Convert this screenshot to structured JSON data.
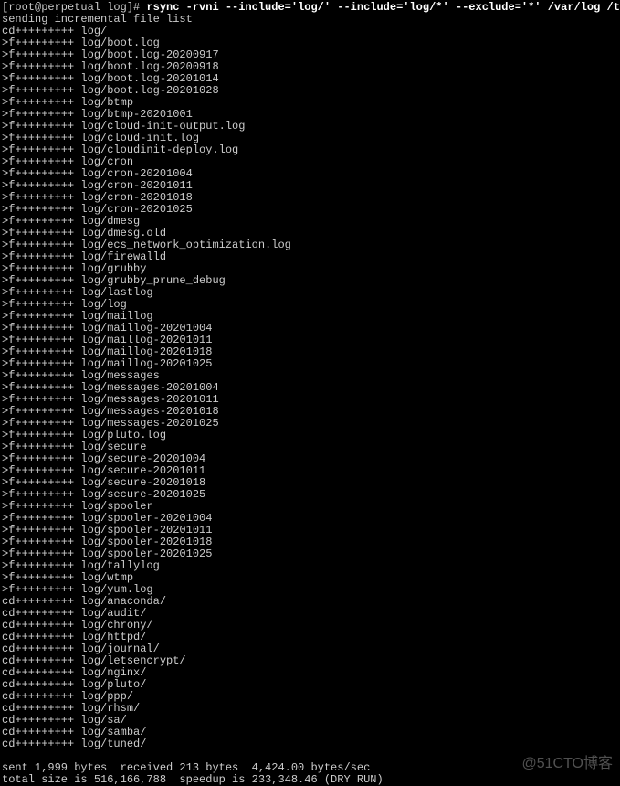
{
  "prompt": {
    "user_host": "[root@perpetual log]# ",
    "command": "rsync -rvni --include='log/' --include='log/*' --exclude='*' /var/log /tmp"
  },
  "header_line": "sending incremental file list",
  "entries": [
    {
      "flags": "cd+++++++++",
      "path": "log/"
    },
    {
      "flags": ">f+++++++++",
      "path": "log/boot.log"
    },
    {
      "flags": ">f+++++++++",
      "path": "log/boot.log-20200917"
    },
    {
      "flags": ">f+++++++++",
      "path": "log/boot.log-20200918"
    },
    {
      "flags": ">f+++++++++",
      "path": "log/boot.log-20201014"
    },
    {
      "flags": ">f+++++++++",
      "path": "log/boot.log-20201028"
    },
    {
      "flags": ">f+++++++++",
      "path": "log/btmp"
    },
    {
      "flags": ">f+++++++++",
      "path": "log/btmp-20201001"
    },
    {
      "flags": ">f+++++++++",
      "path": "log/cloud-init-output.log"
    },
    {
      "flags": ">f+++++++++",
      "path": "log/cloud-init.log"
    },
    {
      "flags": ">f+++++++++",
      "path": "log/cloudinit-deploy.log"
    },
    {
      "flags": ">f+++++++++",
      "path": "log/cron"
    },
    {
      "flags": ">f+++++++++",
      "path": "log/cron-20201004"
    },
    {
      "flags": ">f+++++++++",
      "path": "log/cron-20201011"
    },
    {
      "flags": ">f+++++++++",
      "path": "log/cron-20201018"
    },
    {
      "flags": ">f+++++++++",
      "path": "log/cron-20201025"
    },
    {
      "flags": ">f+++++++++",
      "path": "log/dmesg"
    },
    {
      "flags": ">f+++++++++",
      "path": "log/dmesg.old"
    },
    {
      "flags": ">f+++++++++",
      "path": "log/ecs_network_optimization.log"
    },
    {
      "flags": ">f+++++++++",
      "path": "log/firewalld"
    },
    {
      "flags": ">f+++++++++",
      "path": "log/grubby"
    },
    {
      "flags": ">f+++++++++",
      "path": "log/grubby_prune_debug"
    },
    {
      "flags": ">f+++++++++",
      "path": "log/lastlog"
    },
    {
      "flags": ">f+++++++++",
      "path": "log/log"
    },
    {
      "flags": ">f+++++++++",
      "path": "log/maillog"
    },
    {
      "flags": ">f+++++++++",
      "path": "log/maillog-20201004"
    },
    {
      "flags": ">f+++++++++",
      "path": "log/maillog-20201011"
    },
    {
      "flags": ">f+++++++++",
      "path": "log/maillog-20201018"
    },
    {
      "flags": ">f+++++++++",
      "path": "log/maillog-20201025"
    },
    {
      "flags": ">f+++++++++",
      "path": "log/messages"
    },
    {
      "flags": ">f+++++++++",
      "path": "log/messages-20201004"
    },
    {
      "flags": ">f+++++++++",
      "path": "log/messages-20201011"
    },
    {
      "flags": ">f+++++++++",
      "path": "log/messages-20201018"
    },
    {
      "flags": ">f+++++++++",
      "path": "log/messages-20201025"
    },
    {
      "flags": ">f+++++++++",
      "path": "log/pluto.log"
    },
    {
      "flags": ">f+++++++++",
      "path": "log/secure"
    },
    {
      "flags": ">f+++++++++",
      "path": "log/secure-20201004"
    },
    {
      "flags": ">f+++++++++",
      "path": "log/secure-20201011"
    },
    {
      "flags": ">f+++++++++",
      "path": "log/secure-20201018"
    },
    {
      "flags": ">f+++++++++",
      "path": "log/secure-20201025"
    },
    {
      "flags": ">f+++++++++",
      "path": "log/spooler"
    },
    {
      "flags": ">f+++++++++",
      "path": "log/spooler-20201004"
    },
    {
      "flags": ">f+++++++++",
      "path": "log/spooler-20201011"
    },
    {
      "flags": ">f+++++++++",
      "path": "log/spooler-20201018"
    },
    {
      "flags": ">f+++++++++",
      "path": "log/spooler-20201025"
    },
    {
      "flags": ">f+++++++++",
      "path": "log/tallylog"
    },
    {
      "flags": ">f+++++++++",
      "path": "log/wtmp"
    },
    {
      "flags": ">f+++++++++",
      "path": "log/yum.log"
    },
    {
      "flags": "cd+++++++++",
      "path": "log/anaconda/"
    },
    {
      "flags": "cd+++++++++",
      "path": "log/audit/"
    },
    {
      "flags": "cd+++++++++",
      "path": "log/chrony/"
    },
    {
      "flags": "cd+++++++++",
      "path": "log/httpd/"
    },
    {
      "flags": "cd+++++++++",
      "path": "log/journal/"
    },
    {
      "flags": "cd+++++++++",
      "path": "log/letsencrypt/"
    },
    {
      "flags": "cd+++++++++",
      "path": "log/nginx/"
    },
    {
      "flags": "cd+++++++++",
      "path": "log/pluto/"
    },
    {
      "flags": "cd+++++++++",
      "path": "log/ppp/"
    },
    {
      "flags": "cd+++++++++",
      "path": "log/rhsm/"
    },
    {
      "flags": "cd+++++++++",
      "path": "log/sa/"
    },
    {
      "flags": "cd+++++++++",
      "path": "log/samba/"
    },
    {
      "flags": "cd+++++++++",
      "path": "log/tuned/"
    }
  ],
  "summary": {
    "line1": "sent 1,999 bytes  received 213 bytes  4,424.00 bytes/sec",
    "line2": "total size is 516,166,788  speedup is 233,348.46 (DRY RUN)"
  },
  "watermark": "@51CTO博客"
}
